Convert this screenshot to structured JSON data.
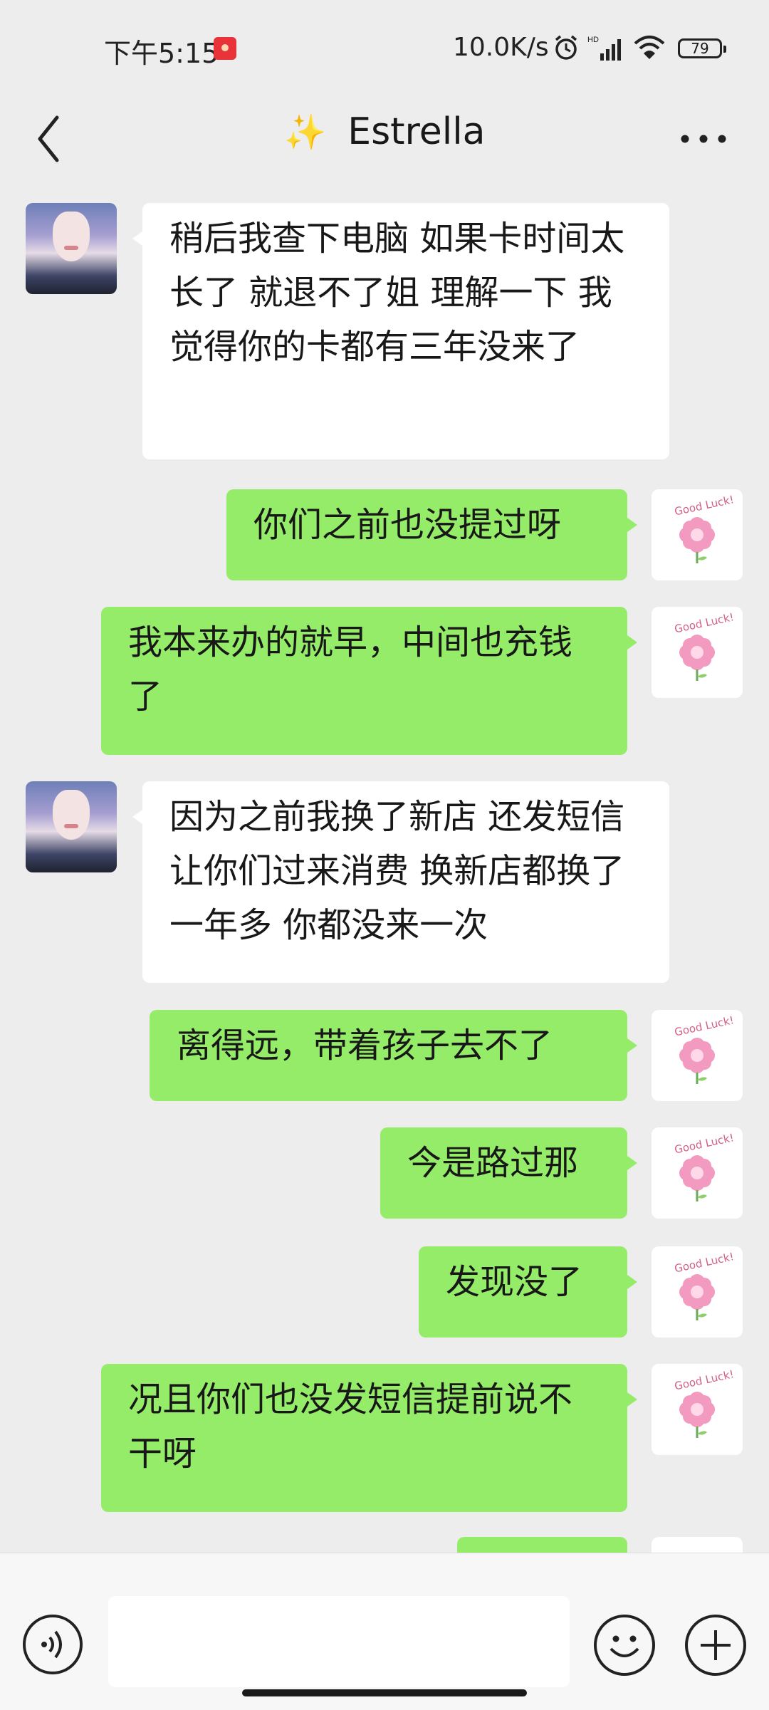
{
  "status_bar": {
    "time": "下午5:15",
    "net_speed": "10.0K/s",
    "battery": "79"
  },
  "header": {
    "sparkle": "✨",
    "contact_name": "Estrella"
  },
  "avatar_sticker_text": "Good Luck!",
  "messages": [
    {
      "side": "left",
      "text": "稍后我查下电脑  如果卡时间太长了  就退不了姐    理解一下  我觉得你的卡都有三年没来了"
    },
    {
      "side": "right",
      "text": "你们之前也没提过呀"
    },
    {
      "side": "right",
      "text": "我本来办的就早，中间也充钱了"
    },
    {
      "side": "left",
      "text": "因为之前我换了新店  还发短信让你们过来消费  换新店都换了一年多  你都没来一次"
    },
    {
      "side": "right",
      "text": "离得远，带着孩子去不了"
    },
    {
      "side": "right",
      "text": "今是路过那"
    },
    {
      "side": "right",
      "text": "发现没了"
    },
    {
      "side": "right",
      "text": "况且你们也没发短信提前说不干呀"
    },
    {
      "side": "right",
      "text": ""
    }
  ],
  "input": {
    "placeholder": ""
  }
}
